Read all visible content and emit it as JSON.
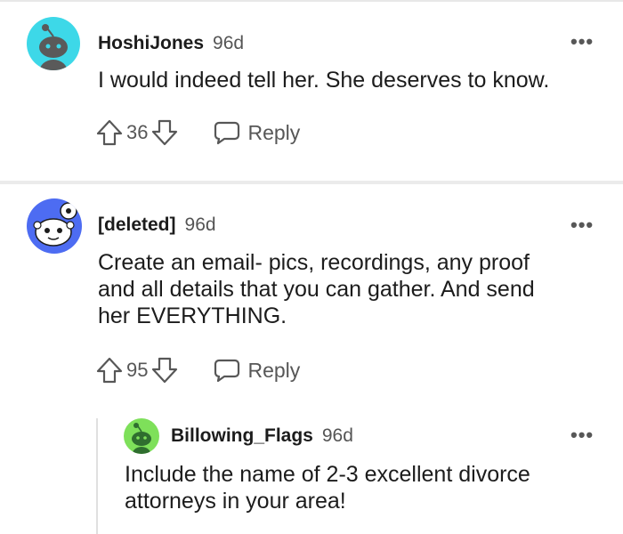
{
  "comments": [
    {
      "author": "HoshiJones",
      "age": "96d",
      "more": "•••",
      "text": "I would indeed tell her. She deserves to know.",
      "score": "36",
      "reply_label": "Reply",
      "avatar_color": "#3dd8e8"
    },
    {
      "author": "[deleted]",
      "age": "96d",
      "more": "•••",
      "text_lines": [
        "Create an email- pics, recordings, any proof",
        "and all details that you can gather. And send",
        "her EVERYTHING."
      ],
      "score": "95",
      "reply_label": "Reply",
      "avatar_color": "#4d6cf2"
    },
    {
      "author": "Billowing_Flags",
      "age": "96d",
      "more": "•••",
      "text_lines": [
        "Include the name of 2-3 excellent divorce",
        "attorneys in your area!"
      ],
      "avatar_color": "#7ee05a"
    }
  ]
}
